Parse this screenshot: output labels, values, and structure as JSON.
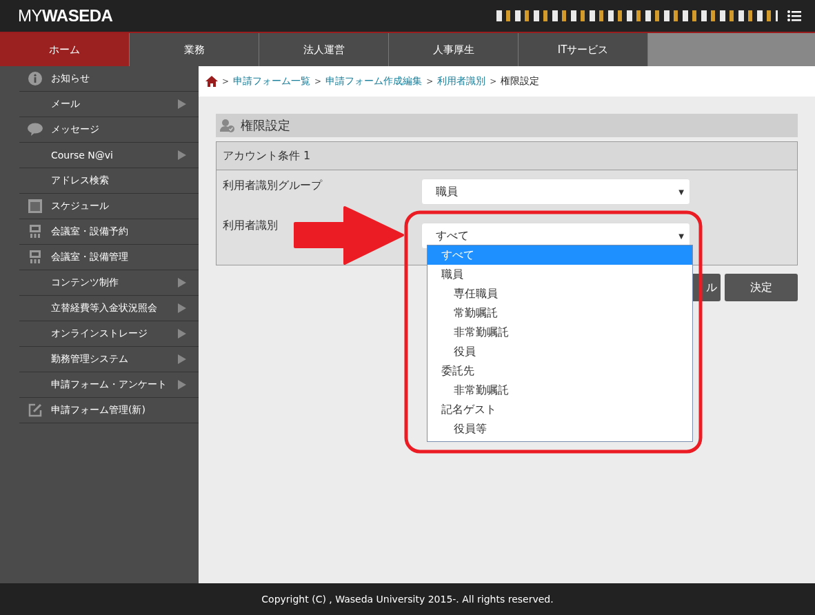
{
  "header": {
    "logo_light": "MY",
    "logo_bold": "WASEDA"
  },
  "nav_tabs": [
    {
      "label": "ホーム",
      "selected": true
    },
    {
      "label": "業務",
      "selected": false
    },
    {
      "label": "法人運営",
      "selected": false
    },
    {
      "label": "人事厚生",
      "selected": false
    },
    {
      "label": "ITサービス",
      "selected": false
    }
  ],
  "sidebar": {
    "items": [
      {
        "label": "お知らせ",
        "kind": "info",
        "submenu": false
      },
      {
        "label": "メール",
        "kind": "plain",
        "submenu": true
      },
      {
        "label": "メッセージ",
        "kind": "chat",
        "submenu": false
      },
      {
        "label": "Course N@vi",
        "kind": "plain",
        "submenu": true
      },
      {
        "label": "アドレス検索",
        "kind": "plain",
        "submenu": false
      },
      {
        "label": "スケジュール",
        "kind": "calendar",
        "submenu": false
      },
      {
        "label": "会議室・設備予約",
        "kind": "room",
        "submenu": false
      },
      {
        "label": "会議室・設備管理",
        "kind": "room",
        "submenu": false
      },
      {
        "label": "コンテンツ制作",
        "kind": "plain",
        "submenu": true
      },
      {
        "label": "立替経費等入金状況照会",
        "kind": "plain",
        "submenu": true
      },
      {
        "label": "オンラインストレージ",
        "kind": "plain",
        "submenu": true
      },
      {
        "label": "勤務管理システム",
        "kind": "plain",
        "submenu": true
      },
      {
        "label": "申請フォーム・アンケート",
        "kind": "plain",
        "submenu": true
      },
      {
        "label": "申請フォーム管理(新)",
        "kind": "edit",
        "submenu": false
      }
    ]
  },
  "breadcrumb": [
    {
      "separator": ">",
      "label": "申請フォーム一覧",
      "kind": "link"
    },
    {
      "separator": ">",
      "label": "申請フォーム作成編集",
      "kind": "link"
    },
    {
      "separator": ">",
      "label": "利用者識別",
      "kind": "link"
    },
    {
      "separator": ">",
      "label": "権限設定",
      "kind": "current"
    }
  ],
  "panel": {
    "title": "権限設定",
    "section_title": "アカウント条件 1",
    "fields": [
      {
        "label": "利用者識別グループ",
        "value": "職員",
        "caret": "▼"
      },
      {
        "label": "利用者識別",
        "value": "すべて",
        "caret": "▼"
      }
    ]
  },
  "dropdown_options": [
    {
      "label": "すべて",
      "selected": true
    },
    {
      "label": "職員",
      "selected": false,
      "children": [
        {
          "label": "専任職員",
          "selected": false
        },
        {
          "label": "常勤嘱託",
          "selected": false
        },
        {
          "label": "非常勤嘱託",
          "selected": false
        },
        {
          "label": "役員",
          "selected": false
        }
      ]
    },
    {
      "label": "委託先",
      "selected": false,
      "children": [
        {
          "label": "非常勤嘱託",
          "selected": false
        }
      ]
    },
    {
      "label": "記名ゲスト",
      "selected": false,
      "children": [
        {
          "label": "役員等",
          "selected": false
        }
      ]
    }
  ],
  "buttons": [
    {
      "label": "ル",
      "kind": "secondary"
    },
    {
      "label": "決定",
      "kind": "primary"
    }
  ],
  "footer": "Copyright (C) , Waseda University 2015-. All rights reserved."
}
